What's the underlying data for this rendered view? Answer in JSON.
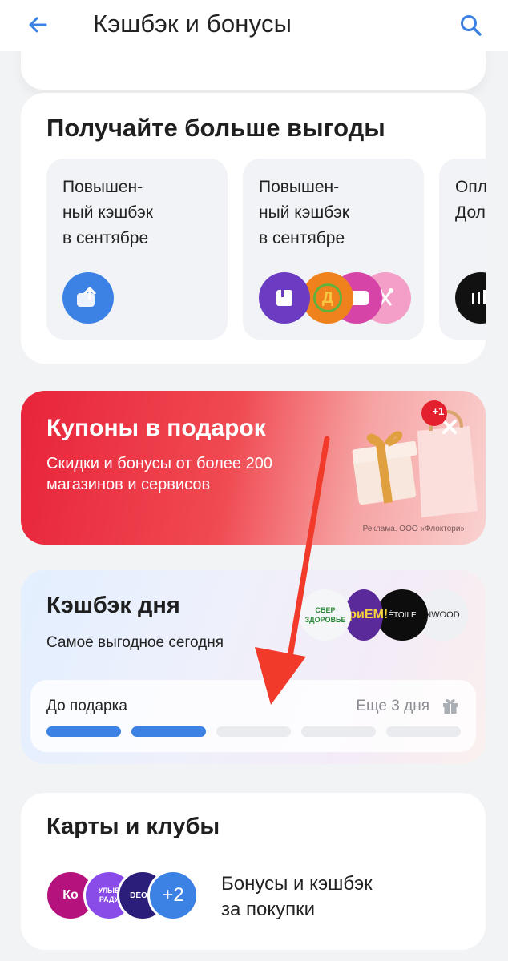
{
  "appbar": {
    "title": "Кэшбэк и бонусы",
    "back_icon": "arrow-left-icon",
    "search_icon": "search-icon",
    "accent": "#3c82e5"
  },
  "benefits": {
    "title": "Получайте больше выгоды",
    "tiles": [
      {
        "label": "Повышен-\nный кэшбэк\nв сентябре"
      },
      {
        "label": "Повышен-\nный кэшбэк\nв сентябре"
      },
      {
        "label": "Опл\nДол"
      }
    ]
  },
  "coupons": {
    "title": "Купоны в подарок",
    "subtitle": "Скидки и бонусы от более 200 магазинов и сервисов",
    "ad": "Реклама. ООО «Флоктори»",
    "badge": "+1"
  },
  "daily": {
    "title": "Кэшбэк дня",
    "subtitle": "Самое выгодное сегодня",
    "logos": [
      "СБЕР ЗДОРОВЬЕ",
      "ПриЕМ!",
      "ÉTOILE",
      "NWOOD"
    ],
    "progress": {
      "label": "До подарка",
      "remaining": "Еще 3 дня",
      "segments_total": 5,
      "segments_done": 2
    }
  },
  "clubs": {
    "title": "Карты и клубы",
    "more_count": "+2",
    "text": "Бонусы и кэшбэк\nза покупки",
    "avatars": [
      "Ко",
      "УЛЫБ РАДУ",
      "DEONI"
    ]
  }
}
